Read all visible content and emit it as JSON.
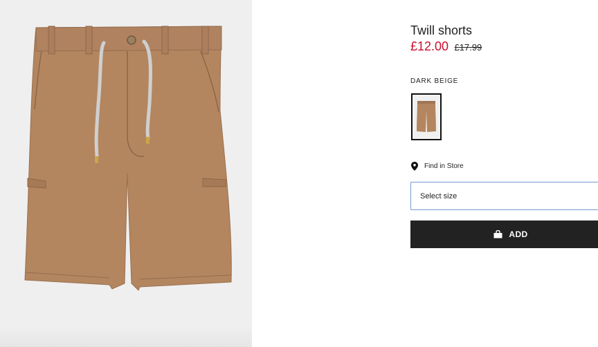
{
  "product": {
    "name": "Twill shorts",
    "price_current": "£12.00",
    "price_original": "£17.99",
    "color_name": "DARK BEIGE",
    "image": "tan-twill-shorts-photo",
    "swatch_image": "tan-twill-shorts-thumbnail"
  },
  "store": {
    "label": "Find in Store",
    "icon": "location-pin-icon"
  },
  "size_select": {
    "placeholder": "Select size"
  },
  "add_button": {
    "label": "ADD",
    "icon": "shopping-bag-icon"
  },
  "colors": {
    "sale_red": "#c8102e",
    "button_black": "#222222",
    "select_border": "#6f9ad1",
    "product_tan": "#b38660"
  }
}
